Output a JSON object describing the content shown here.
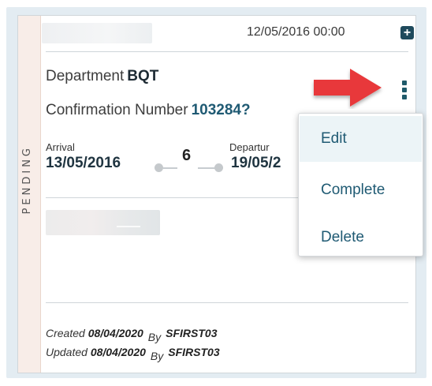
{
  "card": {
    "status": "PENDING",
    "header_datetime": "12/05/2016 00:00",
    "department_label": "Department",
    "department_value": "BQT",
    "confirmation_label": "Confirmation Number",
    "confirmation_value": "103284?",
    "arrival_label": "Arrival",
    "arrival_date": "13/05/2016",
    "nights": "6",
    "departure_label": "Departur",
    "departure_date": "19/05/2",
    "footer": {
      "created_label": "Created",
      "created_date": "08/04/2020",
      "updated_label": "Updated",
      "updated_date": "08/04/2020",
      "by_label": "By",
      "created_by": "SFIRST03",
      "updated_by": "SFIRST03"
    }
  },
  "menu": {
    "items": [
      {
        "label": "Edit"
      },
      {
        "label": "Complete"
      },
      {
        "label": "Delete"
      }
    ]
  },
  "icons": {
    "add": "plus-icon",
    "more": "kebab-icon",
    "pointer": "red-arrow-icon"
  },
  "colors": {
    "accent": "#1f5a73",
    "pending_strip": "#f8ede8",
    "arrow": "#e8383a",
    "outer_bg": "#e3ecf2"
  }
}
